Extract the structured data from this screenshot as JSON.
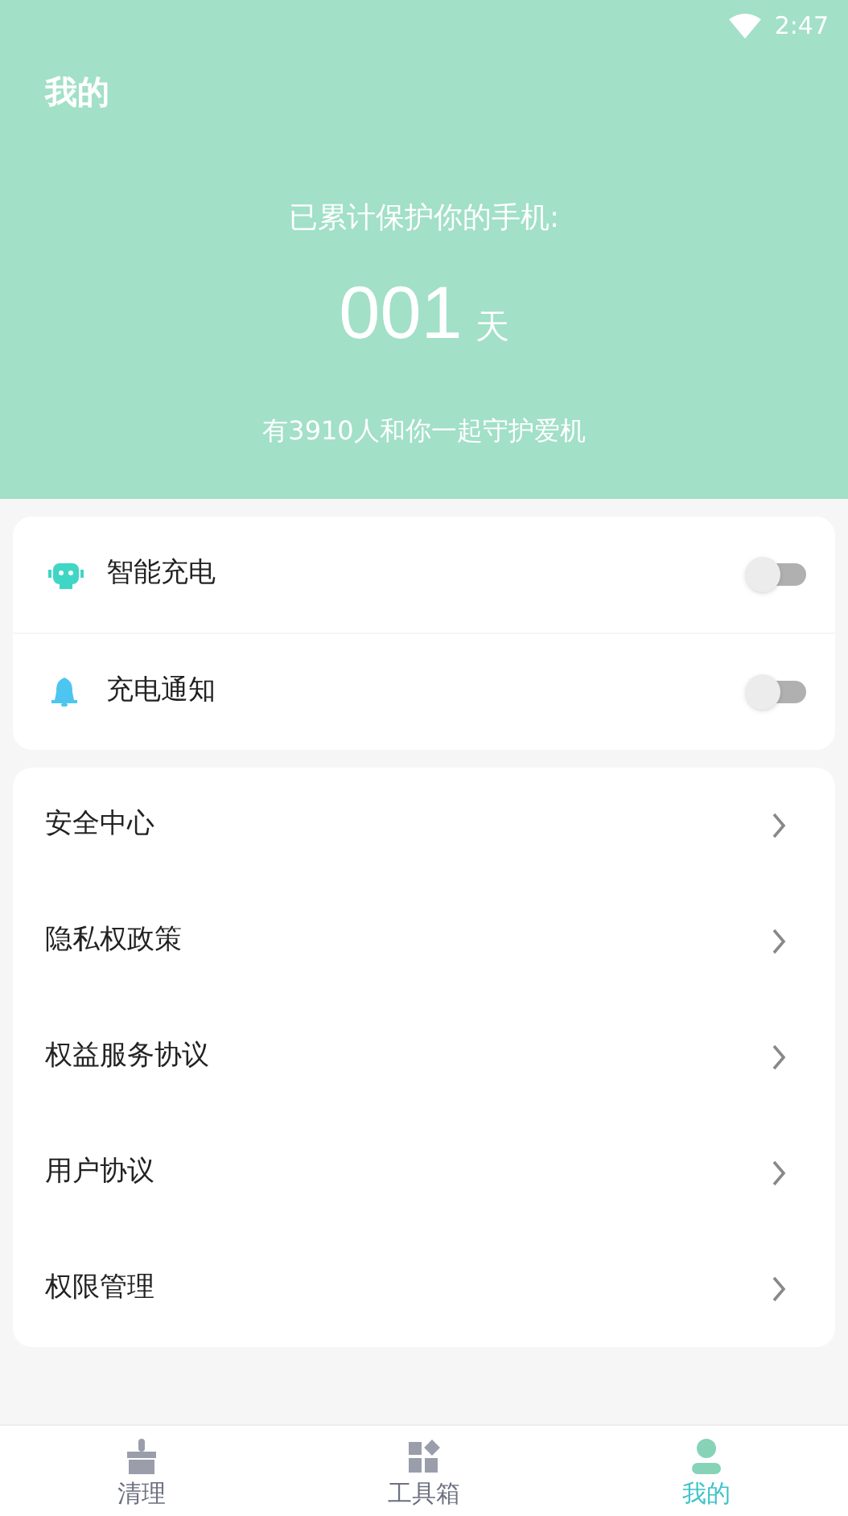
{
  "status_bar": {
    "time": "2:47"
  },
  "header": {
    "title": "我的",
    "caption": "已累计保护你的手机:",
    "days": "001",
    "unit": "天",
    "footnote": "有3910人和你一起守护爱机"
  },
  "toggles": [
    {
      "kind": "robot",
      "label": "智能充电",
      "on": false
    },
    {
      "kind": "bell",
      "label": "充电通知",
      "on": false
    }
  ],
  "menu": [
    {
      "label": "安全中心"
    },
    {
      "label": "隐私权政策"
    },
    {
      "label": "权益服务协议"
    },
    {
      "label": "用户协议"
    },
    {
      "label": "权限管理"
    }
  ],
  "bottom_nav": [
    {
      "kind": "broom",
      "label": "清理",
      "selected": false
    },
    {
      "kind": "tools",
      "label": "工具箱",
      "selected": false
    },
    {
      "kind": "person",
      "label": "我的",
      "selected": true
    }
  ]
}
